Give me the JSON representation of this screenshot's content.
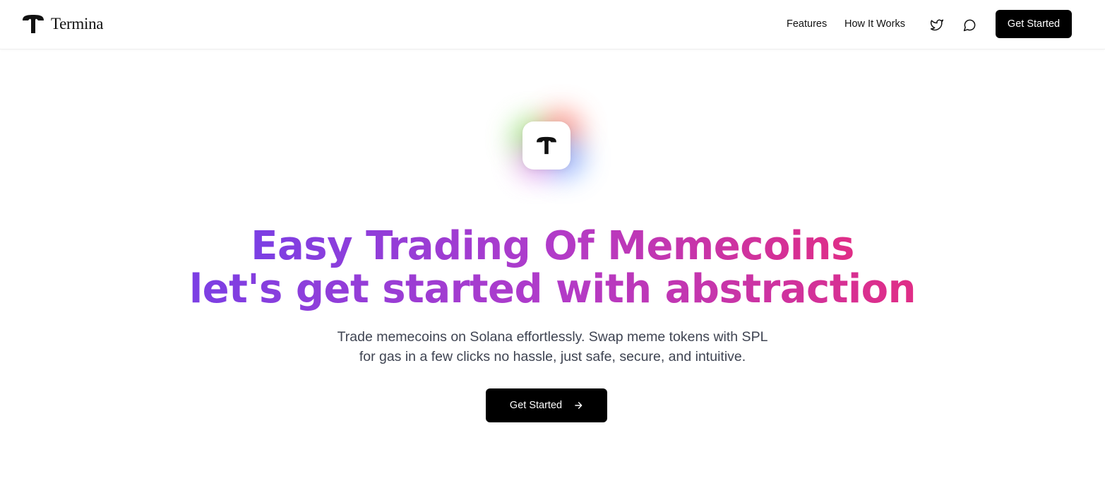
{
  "brand": {
    "name": "Termina",
    "logo_icon": "termina-t-logo-icon"
  },
  "nav": {
    "links": [
      {
        "label": "Features"
      },
      {
        "label": "How It Works"
      }
    ],
    "twitter_icon": "twitter-bird-icon",
    "chat_icon": "chat-bubble-icon",
    "cta_label": "Get Started"
  },
  "hero": {
    "logo_icon": "termina-t-logo-icon",
    "headline_line1": "Easy Trading Of Memecoins",
    "headline_line2": "let's get started with abstraction",
    "subtitle_line1": "Trade memecoins on Solana effortlessly. Swap meme tokens with SPL",
    "subtitle_line2": "for gas in a few clicks no hassle, just safe, secure, and intuitive.",
    "cta_label": "Get Started",
    "cta_icon": "arrow-right-icon"
  },
  "colors": {
    "gradient_start": "#7b3fe4",
    "gradient_mid": "#b13bc9",
    "gradient_end": "#e02d86",
    "button_bg": "#000000",
    "subtitle": "#3f4452"
  }
}
